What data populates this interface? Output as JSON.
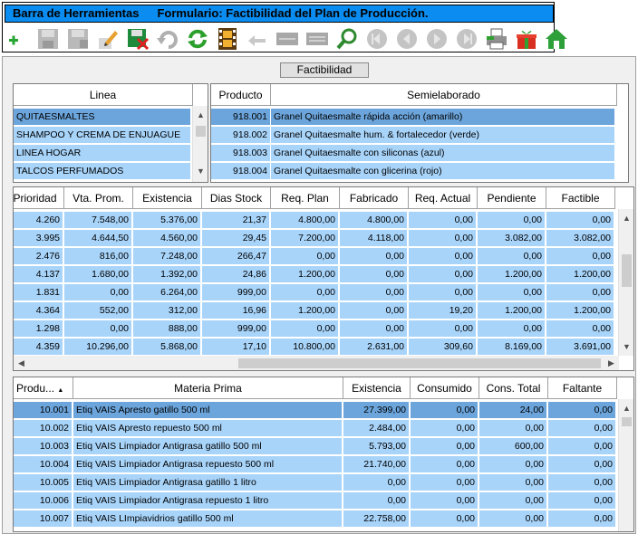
{
  "toolbar": {
    "title": "Barra de Herramientas",
    "form_title": "Formulario: Factibilidad del Plan de Producción.",
    "buttons": [
      {
        "name": "add-icon"
      },
      {
        "name": "save-icon"
      },
      {
        "name": "save-as-icon"
      },
      {
        "name": "edit-icon"
      },
      {
        "name": "delete-icon"
      },
      {
        "name": "undo-icon"
      },
      {
        "name": "refresh-icon"
      },
      {
        "name": "film-icon"
      },
      {
        "name": "back-arrow-icon"
      },
      {
        "name": "minus-icon"
      },
      {
        "name": "equals-icon"
      },
      {
        "name": "search-icon"
      },
      {
        "name": "first-record-icon"
      },
      {
        "name": "previous-record-icon"
      },
      {
        "name": "next-record-icon"
      },
      {
        "name": "last-record-icon"
      },
      {
        "name": "printer-icon"
      },
      {
        "name": "gift-icon"
      },
      {
        "name": "home-icon"
      }
    ]
  },
  "tab": {
    "label": "Factibilidad"
  },
  "lineas": {
    "header": "Linea",
    "rows": [
      "QUITAESMALTES",
      "SHAMPOO Y CREMA DE ENJUAGUE",
      "LINEA HOGAR",
      "TALCOS PERFUMADOS"
    ]
  },
  "productos": {
    "headers": [
      "Producto",
      "Semielaborado"
    ],
    "rows": [
      [
        "918.001",
        "Granel Quitaesmalte rápida acción (amarillo)"
      ],
      [
        "918.002",
        "Granel Quitaesmalte hum. & fortalecedor (verde)"
      ],
      [
        "918.003",
        "Granel Quitaesmalte con siliconas (azul)"
      ],
      [
        "918.004",
        "Granel Quitaesmalte con glicerina (rojo)"
      ]
    ]
  },
  "plan": {
    "headers": [
      "Prioridad",
      "Vta. Prom.",
      "Existencia",
      "Dias Stock",
      "Req. Plan",
      "Fabricado",
      "Req. Actual",
      "Pendiente",
      "Factible"
    ],
    "rows": [
      [
        "4.260",
        "7.548,00",
        "5.376,00",
        "21,37",
        "4.800,00",
        "4.800,00",
        "0,00",
        "0,00",
        "0,00"
      ],
      [
        "3.995",
        "4.644,50",
        "4.560,00",
        "29,45",
        "7.200,00",
        "4.118,00",
        "0,00",
        "3.082,00",
        "3.082,00"
      ],
      [
        "2.476",
        "816,00",
        "7.248,00",
        "266,47",
        "0,00",
        "0,00",
        "0,00",
        "0,00",
        "0,00"
      ],
      [
        "4.137",
        "1.680,00",
        "1.392,00",
        "24,86",
        "1.200,00",
        "0,00",
        "0,00",
        "1.200,00",
        "1.200,00"
      ],
      [
        "1.831",
        "0,00",
        "6.264,00",
        "999,00",
        "0,00",
        "0,00",
        "0,00",
        "0,00",
        "0,00"
      ],
      [
        "4.364",
        "552,00",
        "312,00",
        "16,96",
        "1.200,00",
        "0,00",
        "19,20",
        "1.200,00",
        "1.200,00"
      ],
      [
        "1.298",
        "0,00",
        "888,00",
        "999,00",
        "0,00",
        "0,00",
        "0,00",
        "0,00",
        "0,00"
      ],
      [
        "4.359",
        "10.296,00",
        "5.868,00",
        "17,10",
        "10.800,00",
        "2.631,00",
        "309,60",
        "8.169,00",
        "3.691,00"
      ]
    ]
  },
  "materias": {
    "headers": [
      "Produ...",
      "Materia Prima",
      "Existencia",
      "Consumido",
      "Cons. Total",
      "Faltante"
    ],
    "rows": [
      [
        "10.001",
        "Etiq VAIS Apresto gatillo 500 ml",
        "27.399,00",
        "0,00",
        "24,00",
        "0,00"
      ],
      [
        "10.002",
        "Etiq VAIS Apresto repuesto 500 ml",
        "2.484,00",
        "0,00",
        "0,00",
        "0,00"
      ],
      [
        "10.003",
        "Etiq VAIS Limpiador Antigrasa gatillo 500 ml",
        "5.793,00",
        "0,00",
        "600,00",
        "0,00"
      ],
      [
        "10.004",
        "Etiq VAIS Limpiador Antigrasa repuesto 500 ml",
        "21.740,00",
        "0,00",
        "0,00",
        "0,00"
      ],
      [
        "10.005",
        "Etiq VAIS Limpiador Antigrasa gatillo 1 litro",
        "0,00",
        "0,00",
        "0,00",
        "0,00"
      ],
      [
        "10.006",
        "Etiq VAIS Limpiador Antigrasa repuesto 1 litro",
        "0,00",
        "0,00",
        "0,00",
        "0,00"
      ],
      [
        "10.007",
        "Etiq VAIS LImpiavidrios gatillo 500 ml",
        "22.758,00",
        "0,00",
        "0,00",
        "0,00"
      ]
    ]
  },
  "colors": {
    "title_bar": "#0a8cf0",
    "row": "#a8d4fa",
    "selected_row": "#6ca5dc"
  }
}
